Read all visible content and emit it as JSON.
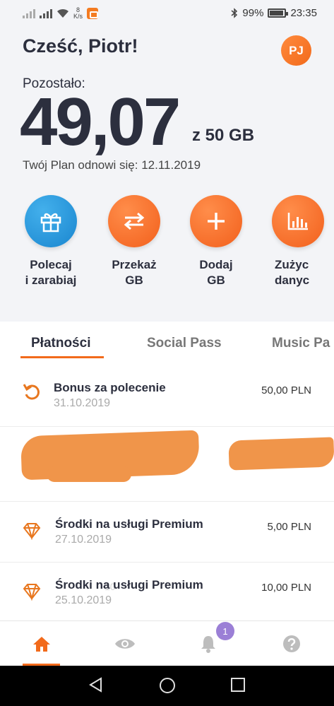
{
  "status_bar": {
    "speed_top": "8",
    "speed_unit": "K/s",
    "battery": "99%",
    "time": "23:35"
  },
  "header": {
    "greeting": "Cześć, Piotr!",
    "avatar_initials": "PJ",
    "remaining_label": "Pozostało:",
    "remaining_value": "49,07",
    "remaining_unit": "z 50 GB",
    "renew_text": "Twój Plan odnowi się: 12.11.2019"
  },
  "actions": [
    {
      "label": "Polecaj\ni zarabiaj",
      "icon": "gift-icon",
      "color": "#1a86cf"
    },
    {
      "label": "Przekaż\nGB",
      "icon": "transfer-arrows-icon",
      "color": "#f2601c"
    },
    {
      "label": "Dodaj\nGB",
      "icon": "plus-icon",
      "color": "#f2601c"
    },
    {
      "label": "Zużyc\ndanyc",
      "icon": "bar-chart-icon",
      "color": "#f2601c"
    }
  ],
  "tabs": [
    {
      "label": "Płatności",
      "active": true
    },
    {
      "label": "Social Pass",
      "active": false
    },
    {
      "label": "Music Pa",
      "active": false
    }
  ],
  "transactions": [
    {
      "title": "Bonus za polecenie",
      "date": "31.10.2019",
      "amount": "50,00 PLN",
      "icon": "refund-arrow-icon"
    },
    {
      "title": "",
      "date": "",
      "amount": "",
      "icon": "redacted",
      "ghost": "10"
    },
    {
      "title": "Środki na usługi Premium",
      "date": "27.10.2019",
      "amount": "5,00 PLN",
      "icon": "diamond-icon"
    },
    {
      "title": "Środki na usługi Premium",
      "date": "25.10.2019",
      "amount": "10,00 PLN",
      "icon": "diamond-icon"
    }
  ],
  "bottom_nav": {
    "items": [
      "home-icon",
      "eye-icon",
      "bell-icon",
      "help-icon"
    ],
    "notification_count": "1"
  },
  "colors": {
    "accent": "#f26a1b",
    "badge": "#9b7fd6",
    "text": "#2c2f3e"
  }
}
